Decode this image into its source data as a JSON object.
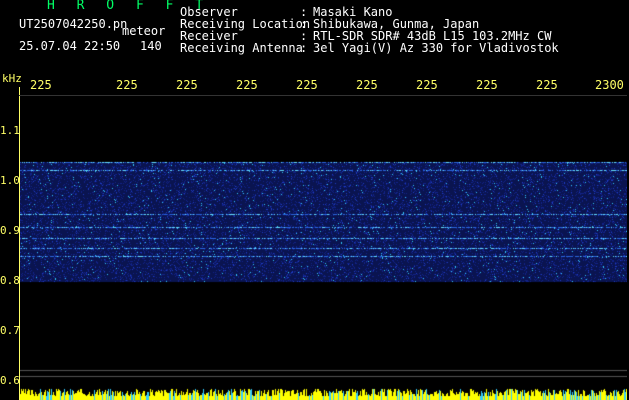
{
  "header": {
    "app_name": "H R O F F T",
    "file_name": "UT2507042250.pn",
    "meteor_label": "meteor",
    "date_time": "25.07.04 22:50",
    "meteor_count": "140",
    "info": [
      {
        "label": "Observer",
        "sep": ":",
        "value": "Masaki Kano"
      },
      {
        "label": "Receiving Location",
        "sep": ":",
        "value": "Shibukawa, Gunma, Japan"
      },
      {
        "label": "Receiver",
        "sep": ":",
        "value": "RTL-SDR SDR# 43dB L15 103.2MHz CW"
      },
      {
        "label": "Receiving Antenna",
        "sep": ":",
        "value": "3el Yagi(V) Az 330 for Vladivostok"
      }
    ]
  },
  "axis": {
    "y_unit": "kHz",
    "y_ticks": [
      "1.1",
      "1.0",
      "0.9",
      "0.8",
      "0.7",
      "0.6"
    ],
    "x_ticks": [
      "225",
      "225",
      "225",
      "225",
      "225",
      "225",
      "225",
      "225",
      "225",
      "2300"
    ]
  },
  "colors": {
    "background": "#000000",
    "text_green": "#00ff66",
    "text_white": "#ffffff",
    "axis_yellow": "#ffff66",
    "noise_band": "#0d1a6e",
    "signal_cyan": "#33ccff",
    "activity_bar": "#ffff00"
  }
}
